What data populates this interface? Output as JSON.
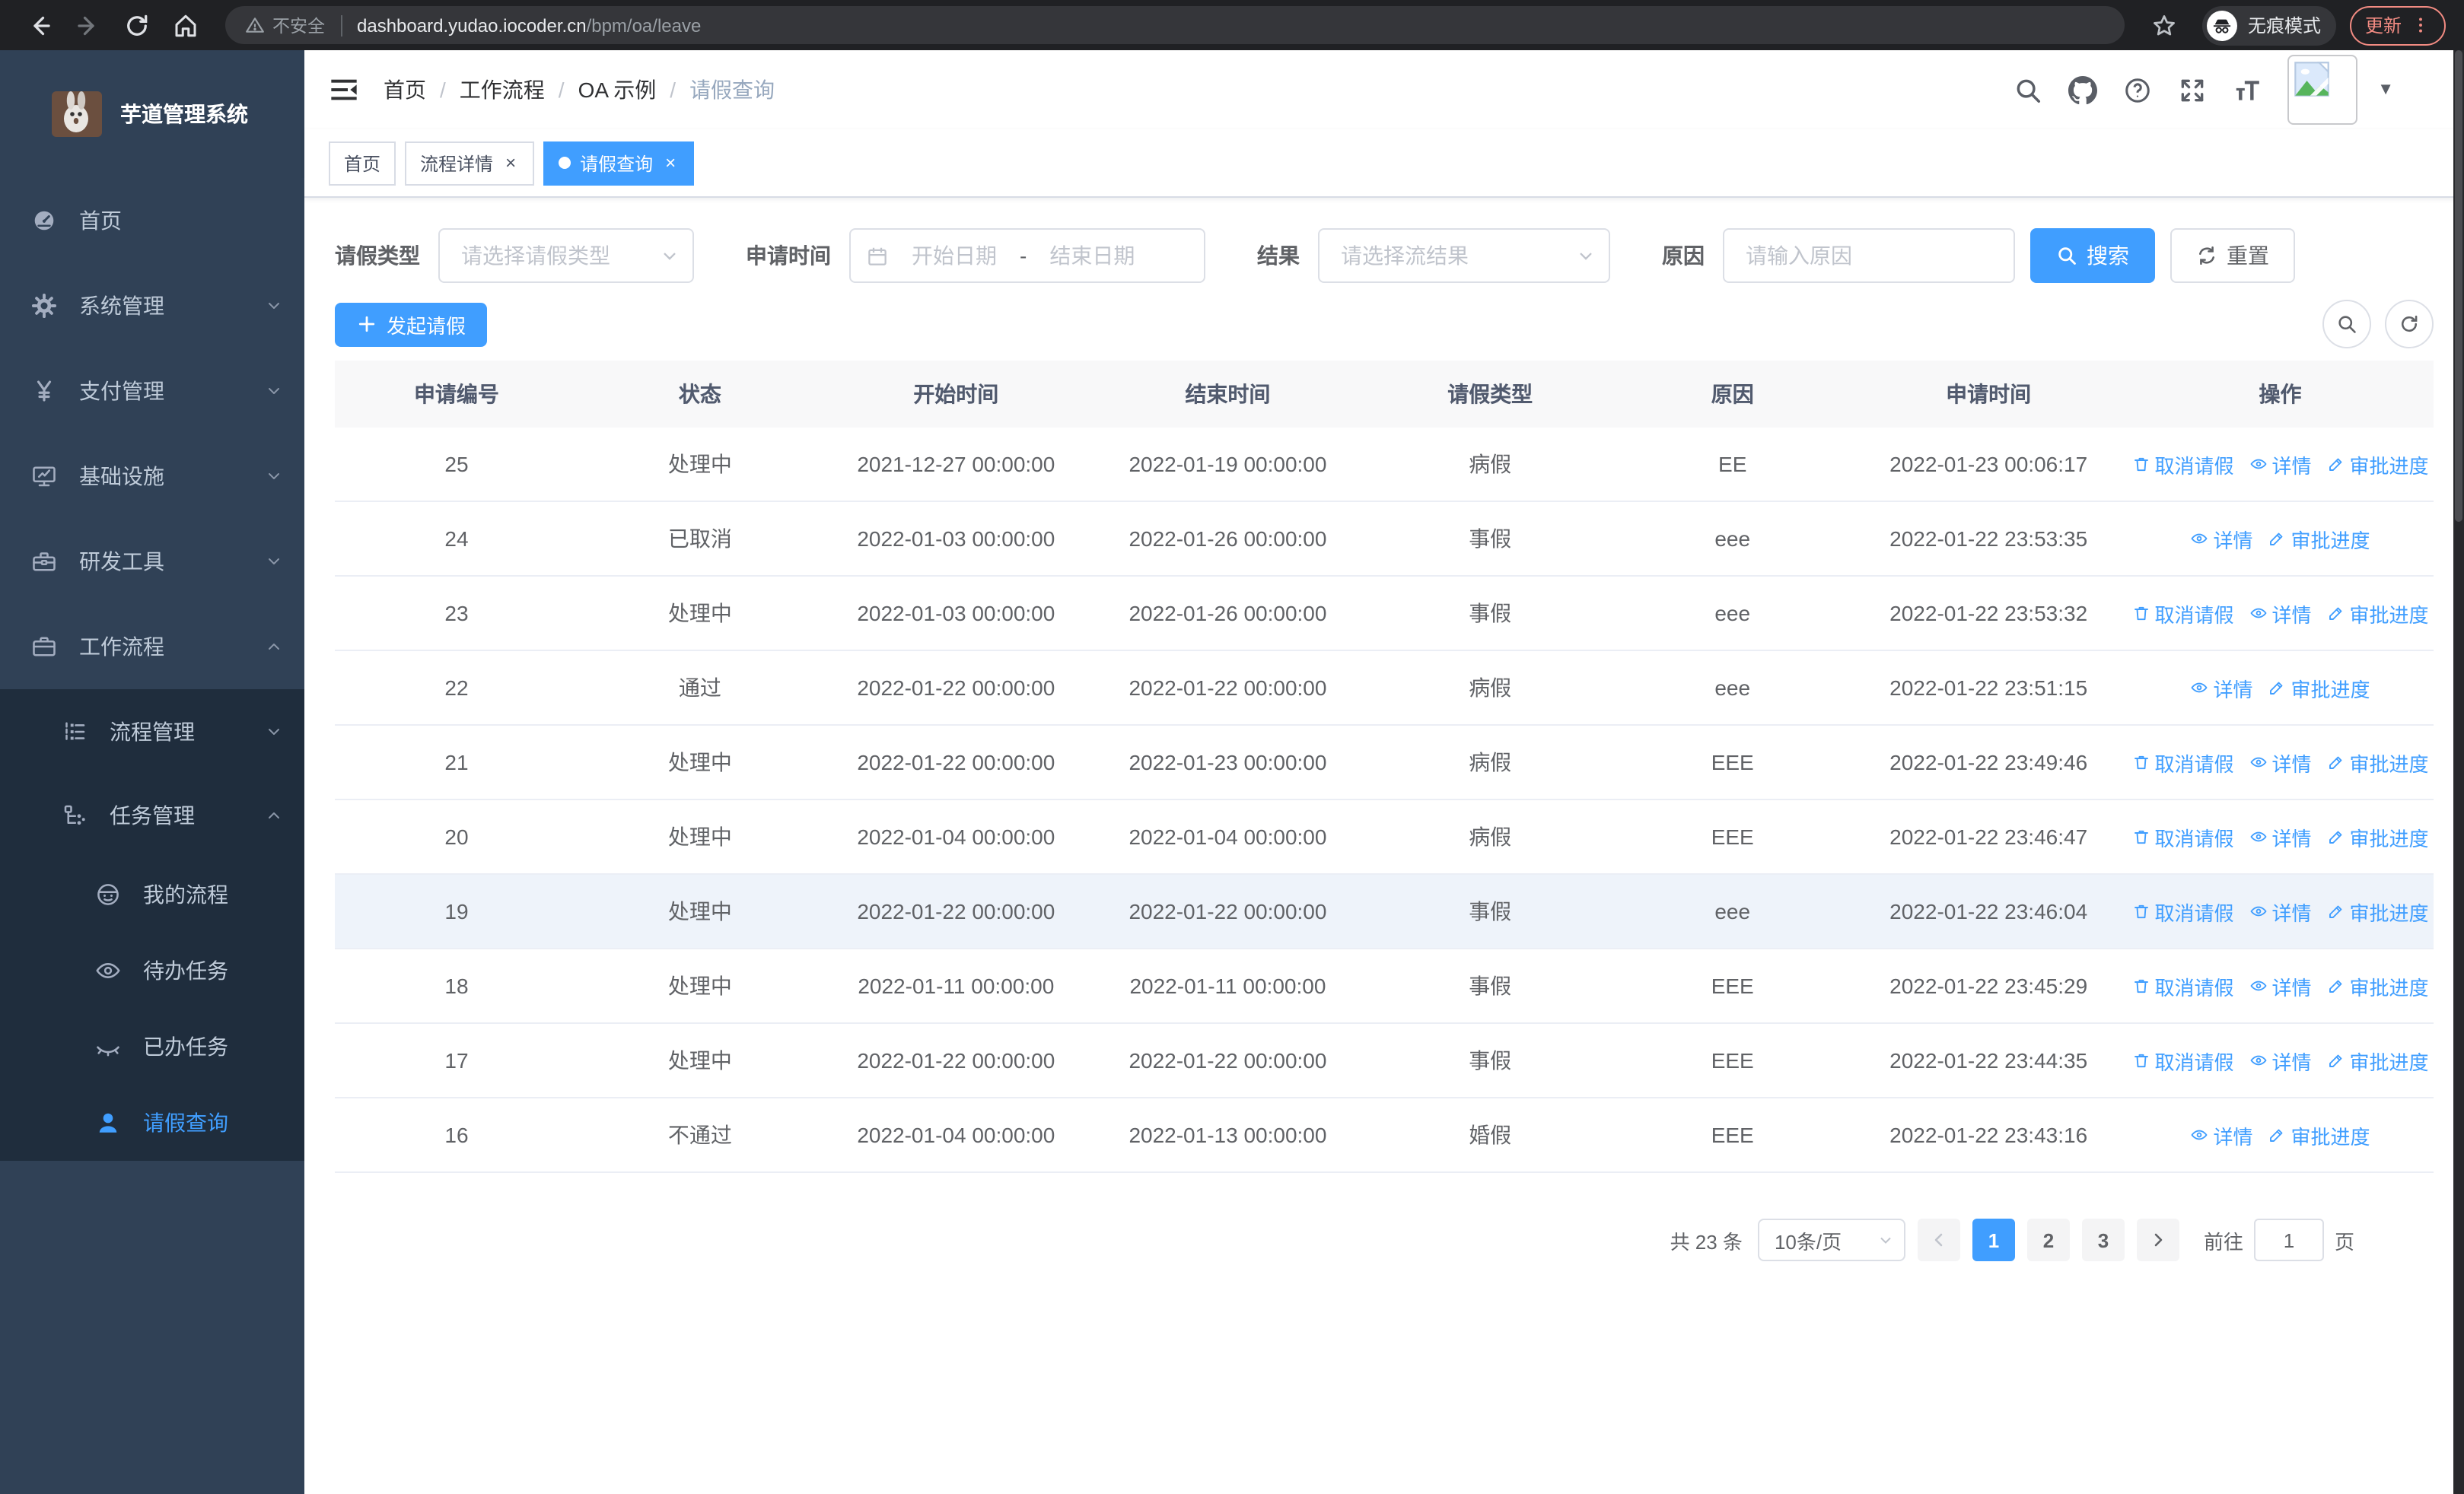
{
  "colors": {
    "accent": "#409eff",
    "sidebar_bg": "#304156",
    "submenu_bg": "#1f2d3d",
    "update_badge": "#f28b82",
    "table_header_bg": "#f8f8f9"
  },
  "browser": {
    "security_label": "不安全",
    "url_host": "dashboard.yudao.iocoder.cn",
    "url_path": "/bpm/oa/leave",
    "incognito_label": "无痕模式",
    "update_label": "更新",
    "icons": [
      "back-arrow-icon",
      "forward-arrow-icon",
      "reload-icon",
      "home-icon",
      "warning-icon",
      "bookmark-star-icon",
      "incognito-icon",
      "kebab-menu-icon"
    ]
  },
  "sidebar": {
    "title": "芋道管理系统",
    "items": [
      {
        "label": "首页",
        "icon": "dashboard-icon",
        "level": 1
      },
      {
        "label": "系统管理",
        "icon": "gear-icon",
        "level": 1,
        "chevron": "down"
      },
      {
        "label": "支付管理",
        "icon": "yen-icon",
        "level": 1,
        "chevron": "down"
      },
      {
        "label": "基础设施",
        "icon": "monitor-icon",
        "level": 1,
        "chevron": "down"
      },
      {
        "label": "研发工具",
        "icon": "toolbox-icon",
        "level": 1,
        "chevron": "down"
      },
      {
        "label": "工作流程",
        "icon": "briefcase-icon",
        "level": 1,
        "chevron": "up"
      },
      {
        "label": "流程管理",
        "icon": "list-tree-icon",
        "level": 2,
        "chevron": "down"
      },
      {
        "label": "任务管理",
        "icon": "task-tree-icon",
        "level": 2,
        "chevron": "up"
      },
      {
        "label": "我的流程",
        "icon": "face-icon",
        "level": 3
      },
      {
        "label": "待办任务",
        "icon": "eye-open-icon",
        "level": 3
      },
      {
        "label": "已办任务",
        "icon": "eye-closed-icon",
        "level": 3
      },
      {
        "label": "请假查询",
        "icon": "user-icon",
        "level": 3,
        "active": true
      }
    ]
  },
  "navbar": {
    "breadcrumbs": [
      "首页",
      "工作流程",
      "OA 示例",
      "请假查询"
    ],
    "icons": [
      "search-icon",
      "github-icon",
      "help-icon",
      "fullscreen-icon",
      "font-size-icon",
      "avatar",
      "caret-down-icon"
    ]
  },
  "tags": [
    {
      "label": "首页",
      "closable": false,
      "active": false
    },
    {
      "label": "流程详情",
      "closable": true,
      "active": false
    },
    {
      "label": "请假查询",
      "closable": true,
      "active": true
    }
  ],
  "filter": {
    "leave_type_label": "请假类型",
    "leave_type_placeholder": "请选择请假类型",
    "apply_time_label": "申请时间",
    "start_placeholder": "开始日期",
    "range_separator": "-",
    "end_placeholder": "结束日期",
    "result_label": "结果",
    "result_placeholder": "请选择流结果",
    "reason_label": "原因",
    "reason_placeholder": "请输入原因",
    "search_label": "搜索",
    "reset_label": "重置"
  },
  "toolbar": {
    "create_label": "发起请假"
  },
  "table": {
    "columns": [
      "申请编号",
      "状态",
      "开始时间",
      "结束时间",
      "请假类型",
      "原因",
      "申请时间",
      "操作"
    ],
    "action_labels": {
      "cancel": "取消请假",
      "detail": "详情",
      "progress": "审批进度"
    },
    "rows": [
      {
        "id": "25",
        "status": "处理中",
        "start": "2021-12-27 00:00:00",
        "end": "2022-01-19 00:00:00",
        "type": "病假",
        "reason": "EE",
        "apply_time": "2022-01-23 00:06:17",
        "actions": [
          "cancel",
          "detail",
          "progress"
        ]
      },
      {
        "id": "24",
        "status": "已取消",
        "start": "2022-01-03 00:00:00",
        "end": "2022-01-26 00:00:00",
        "type": "事假",
        "reason": "eee",
        "apply_time": "2022-01-22 23:53:35",
        "actions": [
          "detail",
          "progress"
        ]
      },
      {
        "id": "23",
        "status": "处理中",
        "start": "2022-01-03 00:00:00",
        "end": "2022-01-26 00:00:00",
        "type": "事假",
        "reason": "eee",
        "apply_time": "2022-01-22 23:53:32",
        "actions": [
          "cancel",
          "detail",
          "progress"
        ]
      },
      {
        "id": "22",
        "status": "通过",
        "start": "2022-01-22 00:00:00",
        "end": "2022-01-22 00:00:00",
        "type": "病假",
        "reason": "eee",
        "apply_time": "2022-01-22 23:51:15",
        "actions": [
          "detail",
          "progress"
        ]
      },
      {
        "id": "21",
        "status": "处理中",
        "start": "2022-01-22 00:00:00",
        "end": "2022-01-23 00:00:00",
        "type": "病假",
        "reason": "EEE",
        "apply_time": "2022-01-22 23:49:46",
        "actions": [
          "cancel",
          "detail",
          "progress"
        ]
      },
      {
        "id": "20",
        "status": "处理中",
        "start": "2022-01-04 00:00:00",
        "end": "2022-01-04 00:00:00",
        "type": "病假",
        "reason": "EEE",
        "apply_time": "2022-01-22 23:46:47",
        "actions": [
          "cancel",
          "detail",
          "progress"
        ]
      },
      {
        "id": "19",
        "status": "处理中",
        "start": "2022-01-22 00:00:00",
        "end": "2022-01-22 00:00:00",
        "type": "事假",
        "reason": "eee",
        "apply_time": "2022-01-22 23:46:04",
        "actions": [
          "cancel",
          "detail",
          "progress"
        ],
        "highlighted": true
      },
      {
        "id": "18",
        "status": "处理中",
        "start": "2022-01-11 00:00:00",
        "end": "2022-01-11 00:00:00",
        "type": "事假",
        "reason": "EEE",
        "apply_time": "2022-01-22 23:45:29",
        "actions": [
          "cancel",
          "detail",
          "progress"
        ]
      },
      {
        "id": "17",
        "status": "处理中",
        "start": "2022-01-22 00:00:00",
        "end": "2022-01-22 00:00:00",
        "type": "事假",
        "reason": "EEE",
        "apply_time": "2022-01-22 23:44:35",
        "actions": [
          "cancel",
          "detail",
          "progress"
        ]
      },
      {
        "id": "16",
        "status": "不通过",
        "start": "2022-01-04 00:00:00",
        "end": "2022-01-13 00:00:00",
        "type": "婚假",
        "reason": "EEE",
        "apply_time": "2022-01-22 23:43:16",
        "actions": [
          "detail",
          "progress"
        ]
      }
    ]
  },
  "pagination": {
    "total_label": "共 23 条",
    "page_size_label": "10条/页",
    "pages": [
      "1",
      "2",
      "3"
    ],
    "active_page": "1",
    "goto_label": "前往",
    "goto_value": "1",
    "goto_suffix": "页"
  }
}
